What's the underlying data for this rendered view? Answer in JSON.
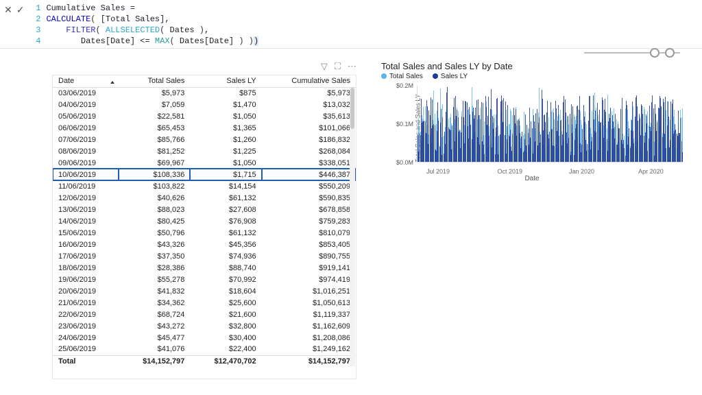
{
  "formula": {
    "lines": [
      {
        "n": "1",
        "html": "<span class='meas'>Cumulative Sales =</span>"
      },
      {
        "n": "2",
        "html": "<span class='kw-calc'>CALCULATE</span><span class='br'>(</span> <span class='meas'>[Total Sales]</span>,"
      },
      {
        "n": "3",
        "html": "    <span class='kw-filt'>FILTER</span><span class='br'>(</span> <span class='kw-all'>ALLSELECTED</span><span class='br'>(</span> Dates <span class='br'>)</span>,"
      },
      {
        "n": "4",
        "html": "    &nbsp;&nbsp;&nbsp;Dates[Date] &lt;= <span class='kw-max'>MAX</span><span class='br'>(</span> Dates[Date] <span class='br'>) )</span><span style='background:#dfeaff;'>)</span>"
      }
    ]
  },
  "table": {
    "headers": [
      "Date",
      "Total Sales",
      "Sales LY",
      "Cumulative Sales"
    ],
    "rows": [
      [
        "03/06/2019",
        "$5,973",
        "$875",
        "$5,973"
      ],
      [
        "04/06/2019",
        "$7,059",
        "$1,470",
        "$13,032"
      ],
      [
        "05/06/2019",
        "$22,581",
        "$1,050",
        "$35,613"
      ],
      [
        "06/06/2019",
        "$65,453",
        "$1,365",
        "$101,066"
      ],
      [
        "07/06/2019",
        "$85,766",
        "$1,260",
        "$186,832"
      ],
      [
        "08/06/2019",
        "$81,252",
        "$1,225",
        "$268,084"
      ],
      [
        "09/06/2019",
        "$69,967",
        "$1,050",
        "$338,051"
      ],
      [
        "10/06/2019",
        "$108,336",
        "$1,715",
        "$446,387"
      ],
      [
        "11/06/2019",
        "$103,822",
        "$14,154",
        "$550,209"
      ],
      [
        "12/06/2019",
        "$40,626",
        "$61,132",
        "$590,835"
      ],
      [
        "13/06/2019",
        "$88,023",
        "$27,608",
        "$678,858"
      ],
      [
        "14/06/2019",
        "$80,425",
        "$76,908",
        "$759,283"
      ],
      [
        "15/06/2019",
        "$50,796",
        "$61,132",
        "$810,079"
      ],
      [
        "16/06/2019",
        "$43,326",
        "$45,356",
        "$853,405"
      ],
      [
        "17/06/2019",
        "$37,350",
        "$74,936",
        "$890,755"
      ],
      [
        "18/06/2019",
        "$28,386",
        "$88,740",
        "$919,141"
      ],
      [
        "19/06/2019",
        "$55,278",
        "$70,992",
        "$974,419"
      ],
      [
        "20/06/2019",
        "$41,832",
        "$18,604",
        "$1,016,251"
      ],
      [
        "21/06/2019",
        "$34,362",
        "$25,600",
        "$1,050,613"
      ],
      [
        "22/06/2019",
        "$68,724",
        "$21,600",
        "$1,119,337"
      ],
      [
        "23/06/2019",
        "$43,272",
        "$32,800",
        "$1,162,609"
      ],
      [
        "24/06/2019",
        "$45,477",
        "$30,400",
        "$1,208,086"
      ],
      [
        "25/06/2019",
        "$41,076",
        "$22,400",
        "$1,249,162"
      ]
    ],
    "highlightRow": 7,
    "footer": [
      "Total",
      "$14,152,797",
      "$12,470,702",
      "$14,152,797"
    ]
  },
  "chart": {
    "title": "Total Sales and Sales LY by Date",
    "legend": [
      {
        "label": "Total Sales",
        "color": "#5bb4e8"
      },
      {
        "label": "Sales LY",
        "color": "#1f3a93"
      }
    ],
    "ylabel": "Total Sales and Sales LY",
    "yticks": [
      {
        "label": "$0.2M",
        "pct": 100
      },
      {
        "label": "$0.1M",
        "pct": 50
      },
      {
        "label": "$0.0M",
        "pct": 0
      }
    ],
    "xticks": [
      {
        "label": "Jul 2019",
        "pct": 8
      },
      {
        "label": "Oct 2019",
        "pct": 35
      },
      {
        "label": "Jan 2020",
        "pct": 62
      },
      {
        "label": "Apr 2020",
        "pct": 88
      }
    ],
    "xlabel": "Date"
  },
  "chart_data": {
    "type": "bar",
    "title": "Total Sales and Sales LY by Date",
    "xlabel": "Date",
    "ylabel": "Total Sales and Sales LY",
    "ylim": [
      0,
      200000
    ],
    "x_range": [
      "Jun 2019",
      "May 2020"
    ],
    "series": [
      {
        "name": "Total Sales",
        "color": "#5bb4e8",
        "approx_range": [
          5000,
          150000
        ],
        "note": "daily values, ~330 bars"
      },
      {
        "name": "Sales LY",
        "color": "#1f3a93",
        "approx_range": [
          1000,
          190000
        ],
        "note": "daily values, overlaid"
      }
    ],
    "yticks": [
      0,
      100000,
      200000
    ],
    "xticks": [
      "Jul 2019",
      "Oct 2019",
      "Jan 2020",
      "Apr 2020"
    ]
  },
  "colors": {
    "totalSales": "#5bb4e8",
    "salesLY": "#1f3a93"
  }
}
